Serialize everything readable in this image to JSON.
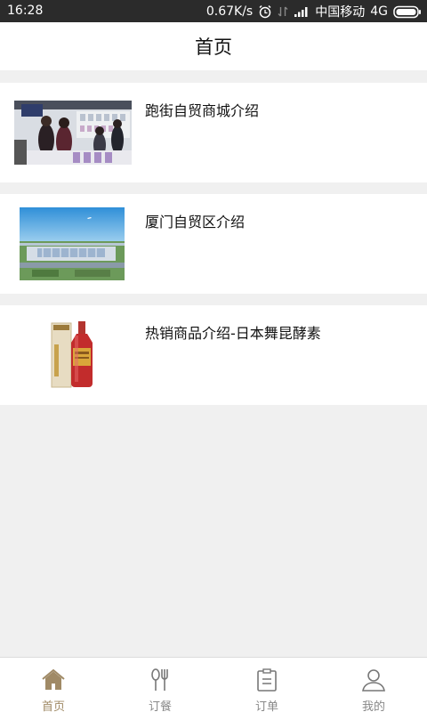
{
  "status_bar": {
    "time": "16:28",
    "speed": "0.67K/s",
    "carrier": "中国移动",
    "network": "4G",
    "icons": [
      "alarm-icon",
      "data-transfer-icon",
      "signal-icon",
      "battery-icon"
    ]
  },
  "header": {
    "title": "首页"
  },
  "articles": [
    {
      "title": "跑街自贸商城介绍",
      "thumb": "store-photo"
    },
    {
      "title": "厦门自贸区介绍",
      "thumb": "trade-zone-aerial-photo"
    },
    {
      "title": "热销商品介绍-日本舞昆酵素",
      "thumb": "enzyme-bottle-photo"
    }
  ],
  "tabs": [
    {
      "label": "首页",
      "icon": "home-icon",
      "active": true
    },
    {
      "label": "订餐",
      "icon": "fork-spoon-icon",
      "active": false
    },
    {
      "label": "订单",
      "icon": "clipboard-icon",
      "active": false
    },
    {
      "label": "我的",
      "icon": "user-icon",
      "active": false
    }
  ],
  "colors": {
    "accent": "#a08a66",
    "inactive": "#888888",
    "status_bar_bg": "#2b2b2b",
    "page_bg": "#f0f0f0"
  }
}
